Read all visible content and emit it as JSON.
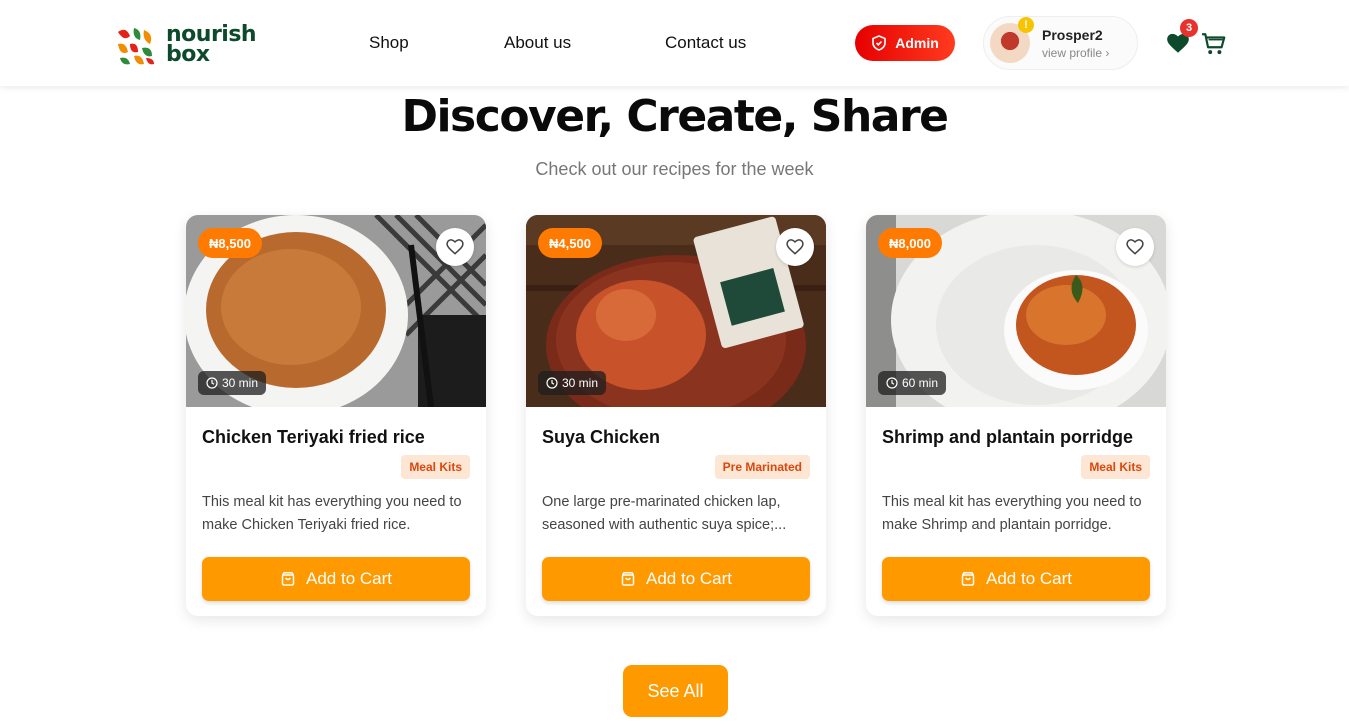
{
  "header": {
    "logo_text_line1": "nourish",
    "logo_text_line2": "box",
    "nav": [
      "Shop",
      "About us",
      "Contact us"
    ],
    "admin_label": "Admin",
    "profile": {
      "name": "Prosper2",
      "sub": "view profile ›",
      "alert": "!"
    },
    "wishlist_count": "3"
  },
  "hero": {
    "title": "Discover, Create, Share",
    "subtitle": "Check out our recipes for the week"
  },
  "cards": [
    {
      "price": "₦8,500",
      "time": "30 min",
      "title": "Chicken Teriyaki fried rice",
      "tag": "Meal Kits",
      "desc": "This meal kit has everything you need to make Chicken Teriyaki fried rice.",
      "button": "Add to Cart"
    },
    {
      "price": "₦4,500",
      "time": "30 min",
      "title": "Suya Chicken",
      "tag": "Pre Marinated",
      "desc": "One large pre-marinated chicken lap, seasoned with authentic suya spice;...",
      "button": "Add to Cart"
    },
    {
      "price": "₦8,000",
      "time": "60 min",
      "title": "Shrimp and plantain porridge",
      "tag": "Meal Kits",
      "desc": "This meal kit has everything you need to make Shrimp and plantain porridge.",
      "button": "Add to Cart"
    }
  ],
  "see_all_label": "See All",
  "colors": {
    "brand_green": "#0d4a2b",
    "accent_orange": "#ff9900",
    "price_orange": "#ff7a00",
    "admin_red": "#e60000"
  }
}
